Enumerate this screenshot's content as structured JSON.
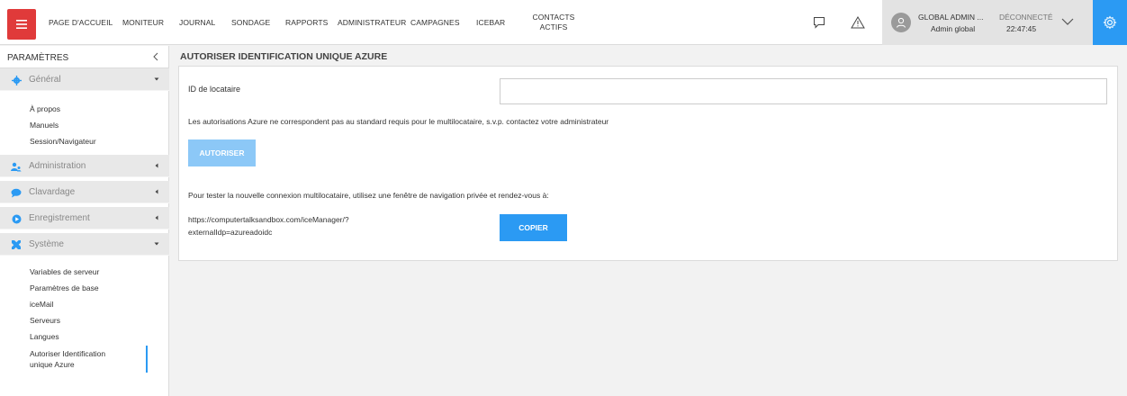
{
  "colors": {
    "accent": "#2b9af3",
    "menu_button": "#e03a3a",
    "disabled_button": "#8cc8f7"
  },
  "header": {
    "nav": [
      "PAGE D'ACCUEIL",
      "MONITEUR",
      "JOURNAL",
      "SONDAGE",
      "RAPPORTS",
      "ADMINISTRATEUR",
      "CAMPAGNES",
      "ICEBAR"
    ],
    "nav_contacts": {
      "line1": "CONTACTS",
      "line2": "ACTIFS"
    },
    "icons": [
      "chat-icon",
      "warning-icon"
    ],
    "user": {
      "name": "GLOBAL ADMIN ...",
      "role": "Admin global",
      "status": "DÉCONNECTÉ",
      "time": "22:47:45"
    }
  },
  "sidebar": {
    "title": "PARAMÈTRES",
    "general": {
      "label": "Général",
      "items": [
        "À propos",
        "Manuels",
        "Session/Navigateur"
      ]
    },
    "sections": [
      "Administration",
      "Clavardage",
      "Enregistrement"
    ],
    "systeme": {
      "label": "Système",
      "items": [
        "Variables de serveur",
        "Paramètres de base",
        "iceMail",
        "Serveurs",
        "Langues"
      ],
      "active_item": {
        "line1": "Autoriser Identification",
        "line2": "unique Azure"
      }
    }
  },
  "main": {
    "title": "AUTORISER IDENTIFICATION UNIQUE AZURE",
    "tenant_label": "ID de locataire",
    "tenant_value": "",
    "warning": "Les autorisations Azure ne correspondent pas au standard requis pour le multilocataire, s.v.p. contactez votre administrateur",
    "authorize_label": "AUTORISER",
    "test_text": "Pour tester la nouvelle connexion multilocataire, utilisez une fenêtre de navigation privée et rendez-vous à:",
    "url_line1": "https://computertalksandbox.com/iceManager/?",
    "url_line2": "externalIdp=azureadoidc",
    "copy_label": "COPIER"
  }
}
